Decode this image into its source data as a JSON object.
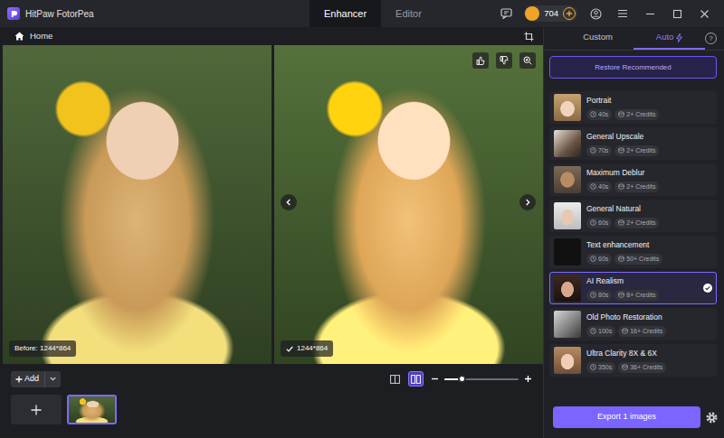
{
  "window": {
    "title": "HitPaw FotorPea"
  },
  "top_tabs": [
    {
      "label": "Enhancer",
      "selected": true
    },
    {
      "label": "Editor",
      "selected": false
    }
  ],
  "credits": {
    "count": "704"
  },
  "toolbar": {
    "home": "Home"
  },
  "compare": {
    "before_label": "Before: 1244*864",
    "after_label": "1244*864"
  },
  "bottom": {
    "add_label": "Add",
    "view_modes": [
      {
        "kind": "slider",
        "selected": false
      },
      {
        "kind": "side",
        "selected": true
      }
    ],
    "zoom": {
      "level": 0.23
    },
    "thumbnails": [
      {
        "selected": true
      }
    ]
  },
  "side_tabs": [
    {
      "label": "Custom",
      "selected": false
    },
    {
      "label": "Auto",
      "selected": true
    }
  ],
  "help": "?",
  "restore_button": "Restore Recommended",
  "models": [
    {
      "name": "Portrait",
      "time": "40s",
      "credits": "2+ Credits",
      "selected": false
    },
    {
      "name": "General Upscale",
      "time": "70s",
      "credits": "2+ Credits",
      "selected": false
    },
    {
      "name": "Maximum Deblur",
      "time": "40s",
      "credits": "2+ Credits",
      "selected": false
    },
    {
      "name": "General Natural",
      "time": "60s",
      "credits": "2+ Credits",
      "selected": false
    },
    {
      "name": "Text enhancement",
      "time": "60s",
      "credits": "50+ Credits",
      "selected": false
    },
    {
      "name": "AI Realism",
      "time": "80s",
      "credits": "8+ Credits",
      "selected": true
    },
    {
      "name": "Old Photo Restoration",
      "time": "100s",
      "credits": "16+ Credits",
      "selected": false
    },
    {
      "name": "Ultra Clarity 8X & 6X",
      "time": "350s",
      "credits": "36+ Credits",
      "selected": false
    }
  ],
  "export_button": "Export 1 images"
}
